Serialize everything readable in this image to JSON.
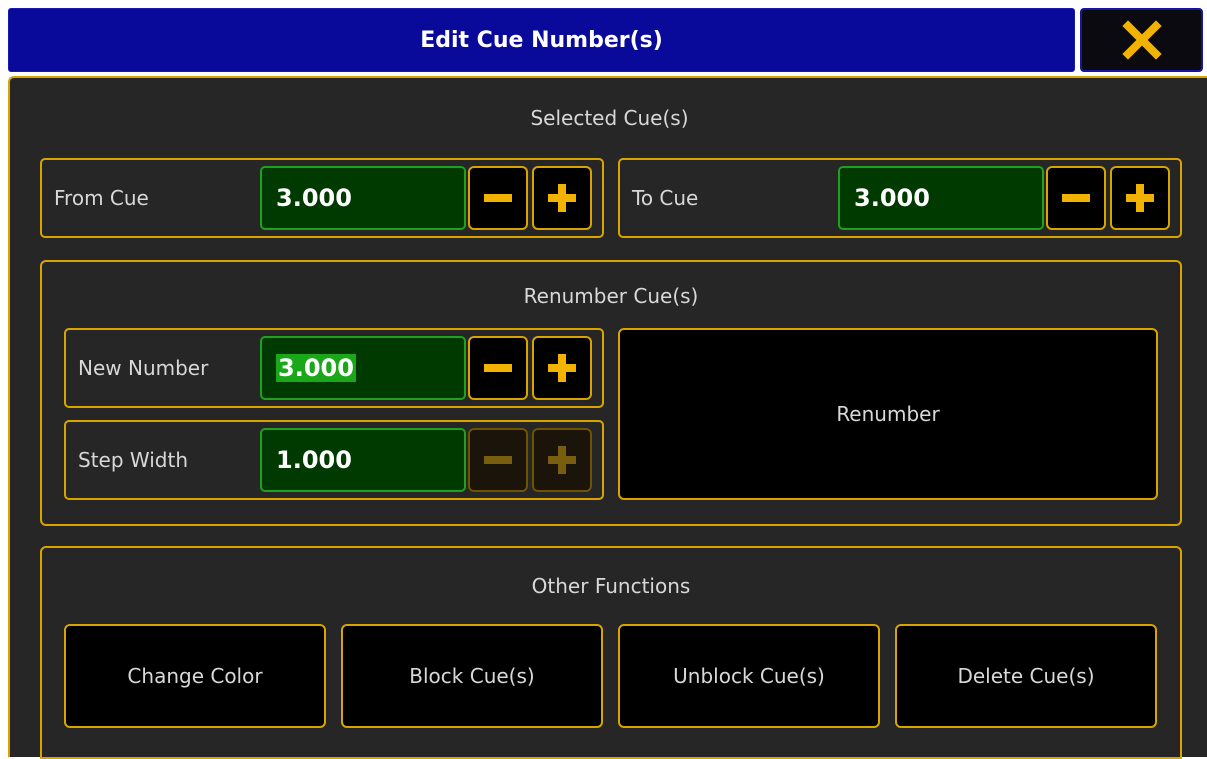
{
  "window": {
    "title": "Edit Cue Number(s)"
  },
  "selected": {
    "section_title": "Selected Cue(s)",
    "from_label": "From Cue",
    "from_value": "3.000",
    "to_label": "To Cue",
    "to_value": "3.000"
  },
  "renumber": {
    "section_title": "Renumber Cue(s)",
    "new_number_label": "New Number",
    "new_number_value": "3.000",
    "step_width_label": "Step Width",
    "step_width_value": "1.000",
    "renumber_button": "Renumber"
  },
  "other": {
    "section_title": "Other Functions",
    "buttons": [
      "Change Color",
      "Block Cue(s)",
      "Unblock Cue(s)",
      "Delete Cue(s)"
    ]
  },
  "icons": {
    "close": "close-icon",
    "minus": "minus-icon",
    "plus": "plus-icon"
  },
  "colors": {
    "accent": "#d9a400",
    "title_bar": "#0a0a9a",
    "value_bg": "#003a00",
    "value_border": "#1fa01f",
    "panel_bg": "#262626"
  }
}
